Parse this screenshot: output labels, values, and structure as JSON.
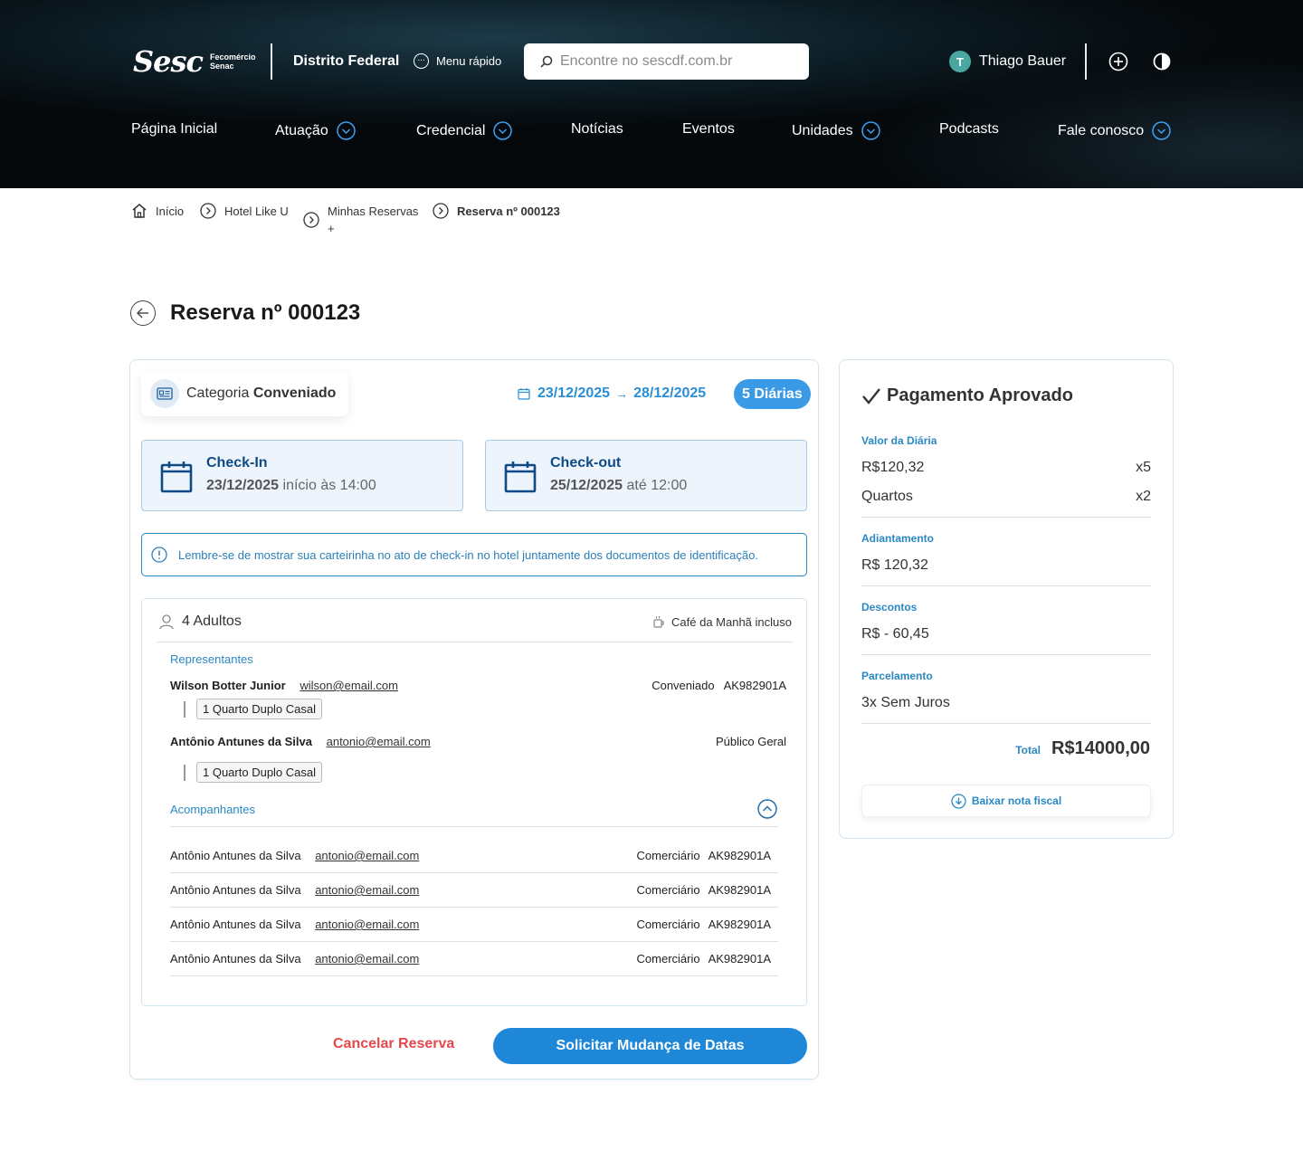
{
  "header": {
    "logo_text": "Sesc",
    "logo_sub_1": "Fecomércio",
    "logo_sub_2": "Senac",
    "region": "Distrito Federal",
    "quick_menu": "Menu rápido",
    "search_placeholder": "Encontre no sescdf.com.br",
    "user_initial": "T",
    "user_name": "Thiago Bauer",
    "icons": [
      "plus-circle-icon",
      "contrast-icon"
    ]
  },
  "nav": {
    "items": [
      {
        "label": "Página Inicial",
        "has_dropdown": false
      },
      {
        "label": "Atuação",
        "has_dropdown": true
      },
      {
        "label": "Credencial",
        "has_dropdown": true
      },
      {
        "label": "Notícias",
        "has_dropdown": false
      },
      {
        "label": "Eventos",
        "has_dropdown": false
      },
      {
        "label": "Unidades",
        "has_dropdown": true
      },
      {
        "label": "Podcasts",
        "has_dropdown": false
      },
      {
        "label": "Fale conosco",
        "has_dropdown": true
      }
    ]
  },
  "breadcrumb": {
    "items": [
      "Início",
      "Hotel Like U",
      "Minhas Reservas",
      "Reserva nº 000123"
    ],
    "minhas_reservas_suffix": "+"
  },
  "page": {
    "title": "Reserva nº 000123"
  },
  "reservation": {
    "category_prefix": "Categoria",
    "category_value": "Conveniado",
    "date_start": "23/12/2025",
    "date_arrow": "→",
    "date_end": "28/12/2025",
    "nights_badge": "5 Diárias",
    "checkin": {
      "title": "Check-In",
      "date": "23/12/2025",
      "detail": "início às 14:00"
    },
    "checkout": {
      "title": "Check-out",
      "date": "25/12/2025",
      "detail": "até 12:00"
    },
    "notice": "Lembre-se de mostrar sua carteirinha no ato de check-in no hotel juntamente dos documentos de identificação.",
    "guests": {
      "adults": "4 Adultos",
      "breakfast": "Café da Manhã incluso",
      "representatives_label": "Representantes",
      "representatives": [
        {
          "name": "Wilson Botter Junior",
          "email": "wilson@email.com",
          "category": "Conveniado",
          "code": "AK982901A",
          "room": "1 Quarto Duplo Casal"
        },
        {
          "name": "Antônio Antunes da Silva",
          "email": "antonio@email.com",
          "category": "Público Geral",
          "code": "",
          "room": "1 Quarto Duplo Casal"
        }
      ],
      "companions_label": "Acompanhantes",
      "companions": [
        {
          "name": "Antônio Antunes da Silva",
          "email": "antonio@email.com",
          "category": "Comerciário",
          "code": "AK982901A"
        },
        {
          "name": "Antônio Antunes da Silva",
          "email": "antonio@email.com",
          "category": "Comerciário",
          "code": "AK982901A"
        },
        {
          "name": "Antônio Antunes da Silva",
          "email": "antonio@email.com",
          "category": "Comerciário",
          "code": "AK982901A"
        },
        {
          "name": "Antônio Antunes da Silva",
          "email": "antonio@email.com",
          "category": "Comerciário",
          "code": "AK982901A"
        }
      ]
    },
    "cancel_label": "Cancelar Reserva",
    "change_label": "Solicitar Mudança de Datas"
  },
  "payment": {
    "title": "Pagamento Aprovado",
    "daily_label": "Valor da Diária",
    "daily_value": "R$120,32",
    "daily_qty": "x5",
    "rooms_label": "Quartos",
    "rooms_qty": "x2",
    "advance_label": "Adiantamento",
    "advance_value": "R$ 120,32",
    "discount_label": "Descontos",
    "discount_value": "R$ - 60,45",
    "installments_label": "Parcelamento",
    "installments_value": "3x Sem Juros",
    "total_label": "Total",
    "total_value": "R$14000,00",
    "invoice_button": "Baixar nota fiscal"
  },
  "colors": {
    "accent": "#1f87d8",
    "link_blue": "#2a88c4",
    "danger": "#e5484d",
    "checkbox_bg": "#edf4fb",
    "dark_blue": "#0e4a85"
  }
}
